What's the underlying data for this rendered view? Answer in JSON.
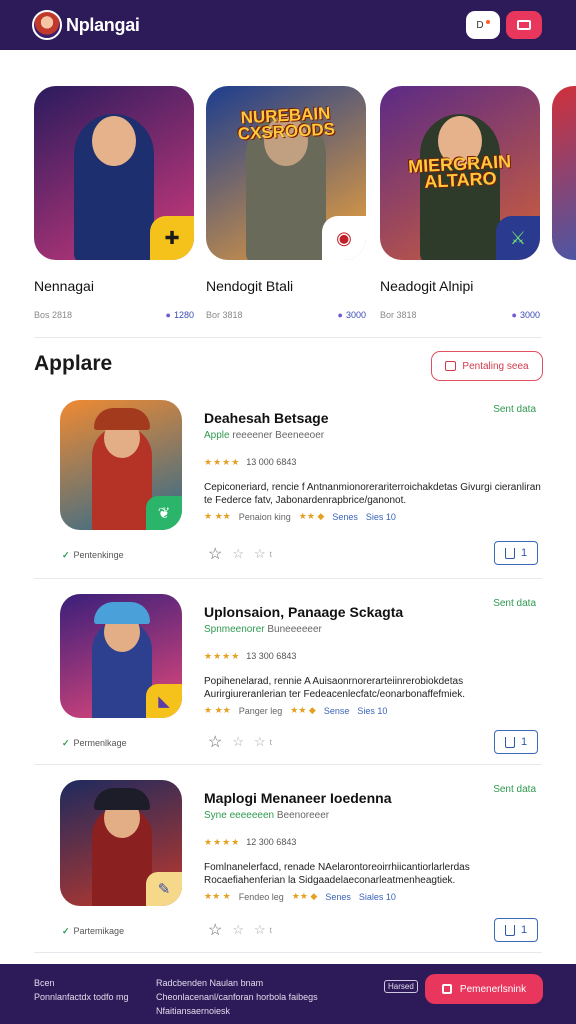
{
  "header": {
    "app_title": "Nplangai",
    "btn_a_label": "D",
    "icons": [
      "avatar-logo",
      "notification-icon",
      "video-icon"
    ]
  },
  "carousel": [
    {
      "title": "Nennagai",
      "meta_left": "Bos 2818",
      "meta_right": "1280",
      "banner": "",
      "colors": [
        "#2a1b5e",
        "#d03a7c"
      ],
      "badge_color": "#f5c21b",
      "badge_icon": "puzzle-icon"
    },
    {
      "title": "Nendogit Btali",
      "meta_left": "Bor 3818",
      "meta_right": "3000",
      "banner": "NUREBAIN CXSROODS",
      "colors": [
        "#1c3d8f",
        "#f0a33a"
      ],
      "badge_color": "#ffffff",
      "badge_icon": "target-icon"
    },
    {
      "title": "Neadogit Alnipi",
      "meta_left": "Bor 3818",
      "meta_right": "3000",
      "banner": "MIERGRAIN ALTARO",
      "colors": [
        "#5b2a86",
        "#d0603a"
      ],
      "badge_color": "#2a3a8f",
      "badge_icon": "sword-icon"
    }
  ],
  "section": {
    "title": "Applare",
    "button_label": "Pentaling seea"
  },
  "list": [
    {
      "title": "Deahesah Betsage",
      "status": "Sent data",
      "sub_prefix": "Apple",
      "sub_dev": "reeeener Beeneeoer",
      "rating": "13 000 6843",
      "description": "Cepiconeriard, rencie f Antnanmionorerariterroichakdetas Givurgi cieranliran te Federce fatv, Jabonardenrapbrice/ganonot.",
      "stat_a": "Penaion king",
      "stat_views": "Senes",
      "stat_count": "Sies 10",
      "tag": "Pentenkinge",
      "art": [
        "#f08a32",
        "#2a6a8f"
      ],
      "hero": "#b43226",
      "hat": "#a33a1e",
      "badge_color": "#2bb56a",
      "badge_icon": "leaf-icon"
    },
    {
      "title": "Uplonsaion, Panaage Sckagta",
      "status": "Sent data",
      "sub_prefix": "Spnmeenorer",
      "sub_dev": "Buneeeeeer",
      "rating": "13 300 6843",
      "description": "Popihenelarad, rennie A Auisaonrnorerarteiinrerobiokdetas Aurirgiureranlerian ter Fedeacenlecfatc/eonarbonaffefmiek.",
      "stat_a": "Panger leg",
      "stat_views": "Sense",
      "stat_count": "Sies 10",
      "tag": "Permenlkage",
      "art": [
        "#3a1f7a",
        "#e4487a"
      ],
      "hero": "#2d3f8f",
      "hat": "#4aa0d8",
      "badge_color": "#f5c21b",
      "badge_icon": "flag-icon"
    },
    {
      "title": "Maplogi Menaneer Ioedenna",
      "status": "Sent data",
      "sub_prefix": "Syne eeeeeeen",
      "sub_dev": "Beenoreeer",
      "rating": "12 300 6843",
      "description": "Fomlnanelerfacd, renade NAelarontoreoirrhiicantiorlarlerdas Rocaefiahenferian la Sidgaadelaeconarleatmenheagtiek.",
      "stat_a": "Fendeo leg",
      "stat_views": "Senes",
      "stat_count": "Siales 10",
      "tag": "Partemikage",
      "art": [
        "#1d2a5e",
        "#c0392b"
      ],
      "hero": "#8a2020",
      "hat": "#1d1d2a",
      "badge_color": "#f5d88a",
      "badge_icon": "feather-icon"
    }
  ],
  "footer": {
    "col1_line1": "Bcen",
    "col1_line2": "Ponnlanfactdx todfo mg",
    "col2_line1": "Radcbenden Naulan bnam",
    "col2_line2": "Cheonlacenanl/canforan horbola faibegs",
    "col2_line3": "Nfaitiansaernoiesk",
    "hint": "Harsed",
    "cta_label": "Pemenerlsnink"
  }
}
